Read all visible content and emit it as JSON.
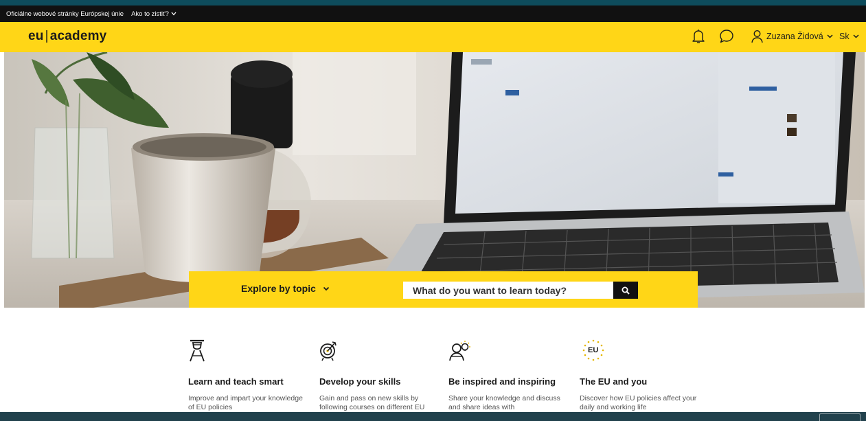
{
  "gov_bar": {
    "official_text": "Oficiálne webové stránky Európskej únie",
    "how_to_know": "Ako to zistiť?"
  },
  "header": {
    "logo_left": "eu",
    "logo_sep": "|",
    "logo_right": "academy",
    "user_name": "Zuzana Židová",
    "language": "Sk"
  },
  "search": {
    "explore_label": "Explore by topic",
    "placeholder": "What do you want to learn today?"
  },
  "features": [
    {
      "icon": "teacher-icon",
      "title": "Learn and teach smart",
      "desc": "Improve and impart your knowledge of EU policies"
    },
    {
      "icon": "target-icon",
      "title": "Develop your skills",
      "desc": "Gain and pass on new skills by following courses on different EU"
    },
    {
      "icon": "idea-person-icon",
      "title": "Be inspired and inspiring",
      "desc": "Share your knowledge and discuss and share ideas with"
    },
    {
      "icon": "eu-stars-icon",
      "title": "The EU and you",
      "desc": "Discover how EU policies affect your daily and working life"
    }
  ],
  "eu_badge": "EU",
  "colors": {
    "brand_yellow": "#ffd617",
    "dark": "#111111",
    "footer_bar": "#21414c"
  }
}
